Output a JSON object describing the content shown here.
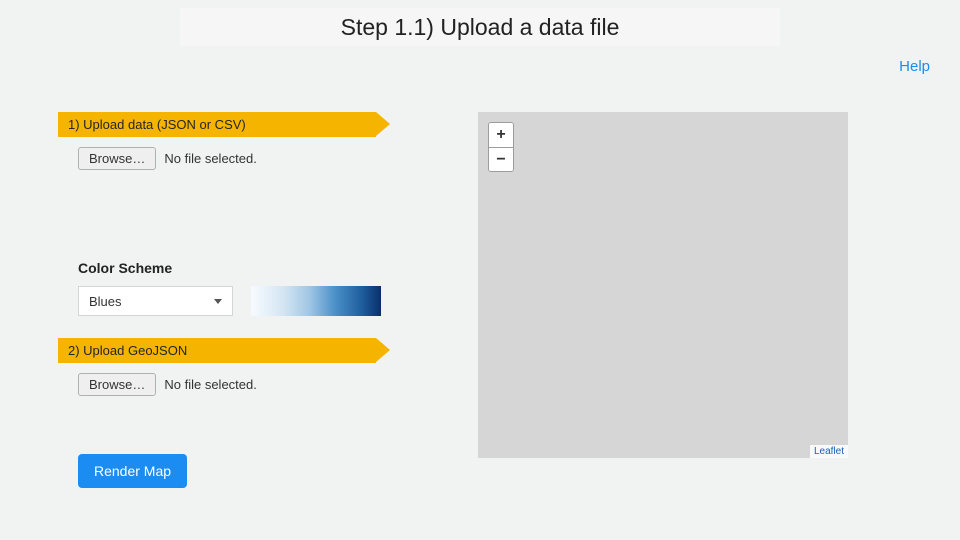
{
  "title": "Step 1.1) Upload a data file",
  "help_label": "Help",
  "steps": {
    "upload_data": {
      "ribbon": "1) Upload data (JSON or CSV)",
      "browse_label": "Browse…",
      "file_status": "No file selected."
    },
    "upload_geojson": {
      "ribbon": "2) Upload GeoJSON",
      "browse_label": "Browse…",
      "file_status": "No file selected."
    }
  },
  "color_scheme": {
    "label": "Color Scheme",
    "selected": "Blues"
  },
  "render_button": "Render Map",
  "map": {
    "zoom_in": "+",
    "zoom_out": "−",
    "attribution": "Leaflet"
  }
}
